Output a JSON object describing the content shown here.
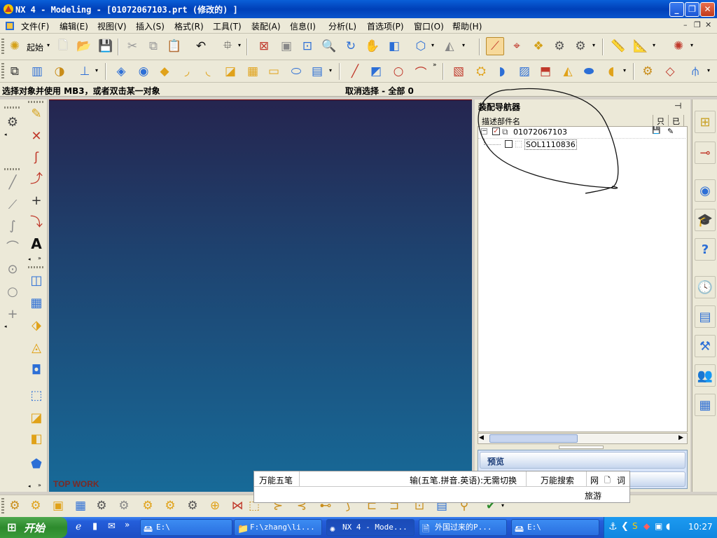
{
  "window": {
    "title": "NX 4 - Modeling - [01072067103.prt (修改的) ]",
    "minimize_icon": "minimize-icon",
    "restore_icon": "restore-icon",
    "close_icon": "close-icon"
  },
  "menu": {
    "items": [
      "文件(F)",
      "编辑(E)",
      "视图(V)",
      "插入(S)",
      "格式(R)",
      "工具(T)",
      "装配(A)",
      "信息(I)",
      "分析(L)",
      "首选项(P)",
      "窗口(O)",
      "帮助(H)"
    ]
  },
  "toolbar": {
    "start_label": "起始"
  },
  "cue": {
    "prompt": "选择对象并使用 MB3，或者双击某一对象",
    "selection": "取消选择 - 全部 0"
  },
  "viewport": {
    "watermark": "TOP WORK"
  },
  "navigator": {
    "title": "装配导航器",
    "column_header": "描述部件名",
    "tree": [
      {
        "name": "01072067103",
        "checked": true
      },
      {
        "name": "SOL1110836",
        "checked": false
      }
    ],
    "preview_label": "预览"
  },
  "ime": {
    "name": "万能五笔",
    "mode": "输(五笔.拼音.英语):无需切换",
    "search": "万能搜索",
    "web": "网",
    "doc": "词",
    "travel": "旅游"
  },
  "taskbar": {
    "start_label": "开始",
    "tasks": [
      {
        "label": "E:\\",
        "icon": "drive-icon"
      },
      {
        "label": "F:\\zhang\\li...",
        "icon": "folder-icon"
      },
      {
        "label": "NX 4 - Mode...",
        "icon": "nx-icon"
      },
      {
        "label": "外国过来的P...",
        "icon": "word-icon"
      },
      {
        "label": "E:\\",
        "icon": "drive-icon"
      }
    ],
    "clock": "10:27"
  },
  "colors": {
    "titlebar": "#0a5fd8",
    "viewport_top": "#25254f",
    "viewport_bottom": "#176a98",
    "taskbar": "#245edb",
    "start_button": "#3a9a3a"
  }
}
